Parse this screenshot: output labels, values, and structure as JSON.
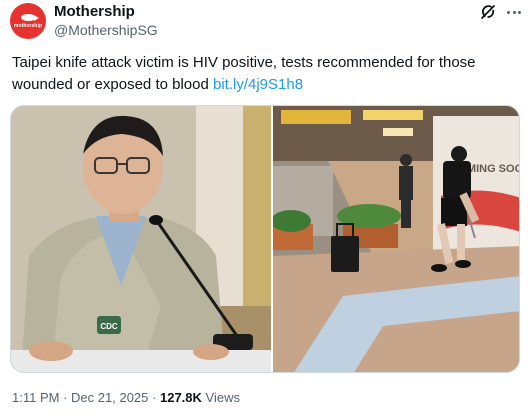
{
  "author": {
    "display_name": "Mothership",
    "handle": "@MothershipSG",
    "avatar_icon": "mothership-logo-icon",
    "avatar_wordmark": "mothership",
    "avatar_color": "#e8322f"
  },
  "header_actions": {
    "grok_icon": "grok-icon",
    "more_icon": "more-options-icon"
  },
  "tweet": {
    "text": "Taipei knife attack victim is HIV positive, tests recommended for those wounded or exposed to blood",
    "link": "bit.ly/4j9S1h8",
    "link_color": "#1d9bf0"
  },
  "media": {
    "photos": [
      {
        "name": "official-at-press-conference-photo",
        "badge_text": "CDC"
      },
      {
        "name": "station-knife-attack-photo",
        "sign_text": "MING SOON"
      }
    ]
  },
  "meta": {
    "time": "1:11 PM",
    "date": "Dec 21, 2025",
    "separator": "·",
    "views_count": "127.8K",
    "views_label": "Views"
  }
}
